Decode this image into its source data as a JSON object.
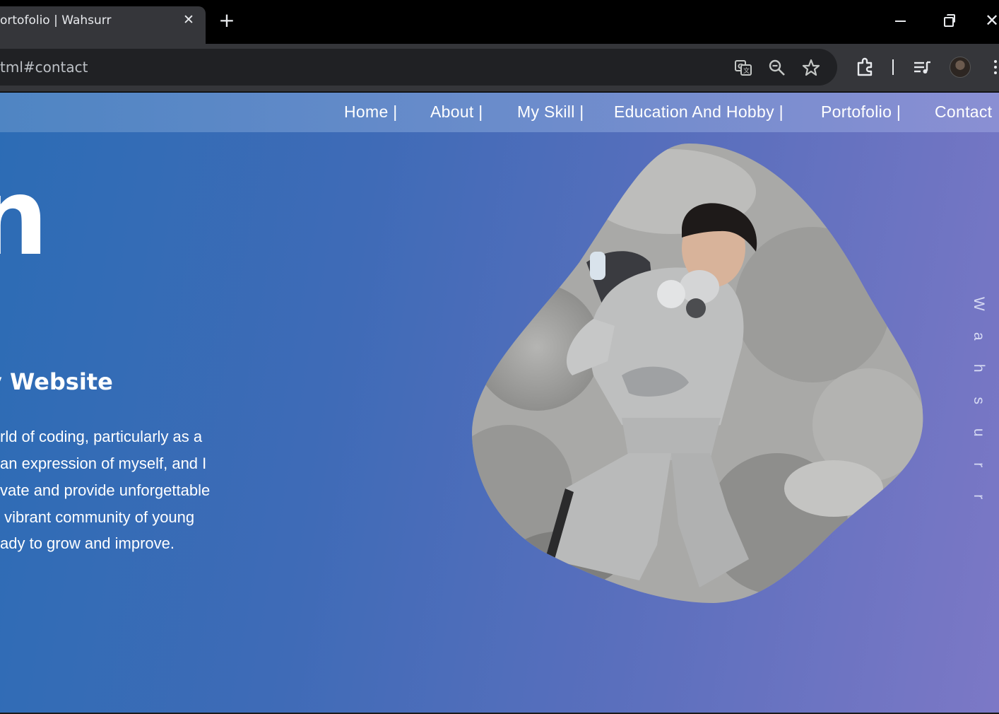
{
  "browser": {
    "tab_title": "ortofolio | Wahsurr",
    "tab_close": "✕",
    "new_tab": "+",
    "url": "tml#contact",
    "window_close": "✕",
    "icons": [
      "translate-icon",
      "zoom-icon",
      "star-icon",
      "extensions-icon",
      "media-control-icon",
      "profile-avatar",
      "menu-icon"
    ]
  },
  "nav": {
    "items": [
      "Home |",
      "About |",
      "My Skill |",
      "Education And Hobby |",
      "Portofolio |",
      "Contact"
    ]
  },
  "hero": {
    "big_letter": "n",
    "subheading": "y Website",
    "paragraph": [
      "rld of coding, particularly as a",
      "an expression of myself, and I",
      "vate and provide unforgettable",
      " vibrant community of young",
      "ady to grow and improve."
    ],
    "vertical_name": [
      "W",
      "a",
      "h",
      "s",
      "u",
      "r",
      "r"
    ]
  },
  "colors": {
    "background_start": "#2c6cb5",
    "background_end": "#7c78c6",
    "text": "#ffffff"
  }
}
